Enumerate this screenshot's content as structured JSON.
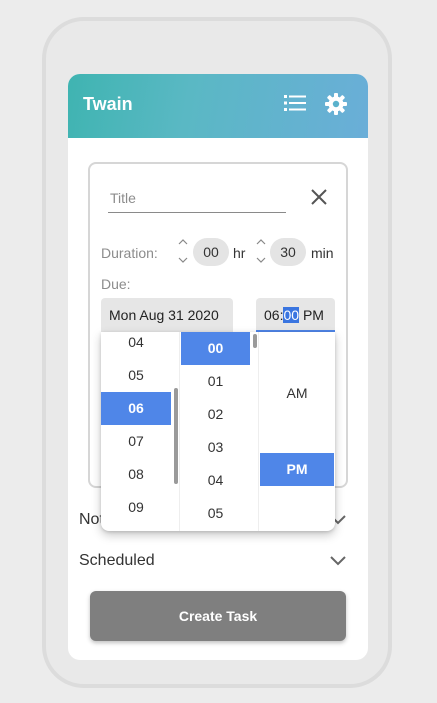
{
  "app": {
    "title": "Twain"
  },
  "form": {
    "title_placeholder": "Title",
    "duration_label": "Duration:",
    "duration_hours": "00",
    "hours_unit": "hr",
    "duration_minutes": "30",
    "minutes_unit": "min",
    "due_label": "Due:",
    "due_date": "Mon Aug 31 2020",
    "due_time_hour": "06",
    "due_time_sep": ":",
    "due_time_minute": "00",
    "due_time_period": "PM"
  },
  "sections": [
    {
      "label": "Notes"
    },
    {
      "label": "Scheduled"
    }
  ],
  "create_button": "Create Task",
  "time_picker": {
    "hours": [
      "04",
      "05",
      "06",
      "07",
      "08",
      "09"
    ],
    "selected_hour": "06",
    "minutes": [
      "00",
      "01",
      "02",
      "03",
      "04",
      "05"
    ],
    "selected_minute": "00",
    "periods": [
      "AM",
      "PM"
    ],
    "selected_period": "PM"
  },
  "colors": {
    "accent": "#4f86e8",
    "header_start": "#3fb4b1",
    "header_end": "#6aaed8",
    "button": "#7f7f7f"
  },
  "icons": [
    "list-icon",
    "gear-icon",
    "close-icon",
    "chevron-up-icon",
    "chevron-down-icon"
  ]
}
